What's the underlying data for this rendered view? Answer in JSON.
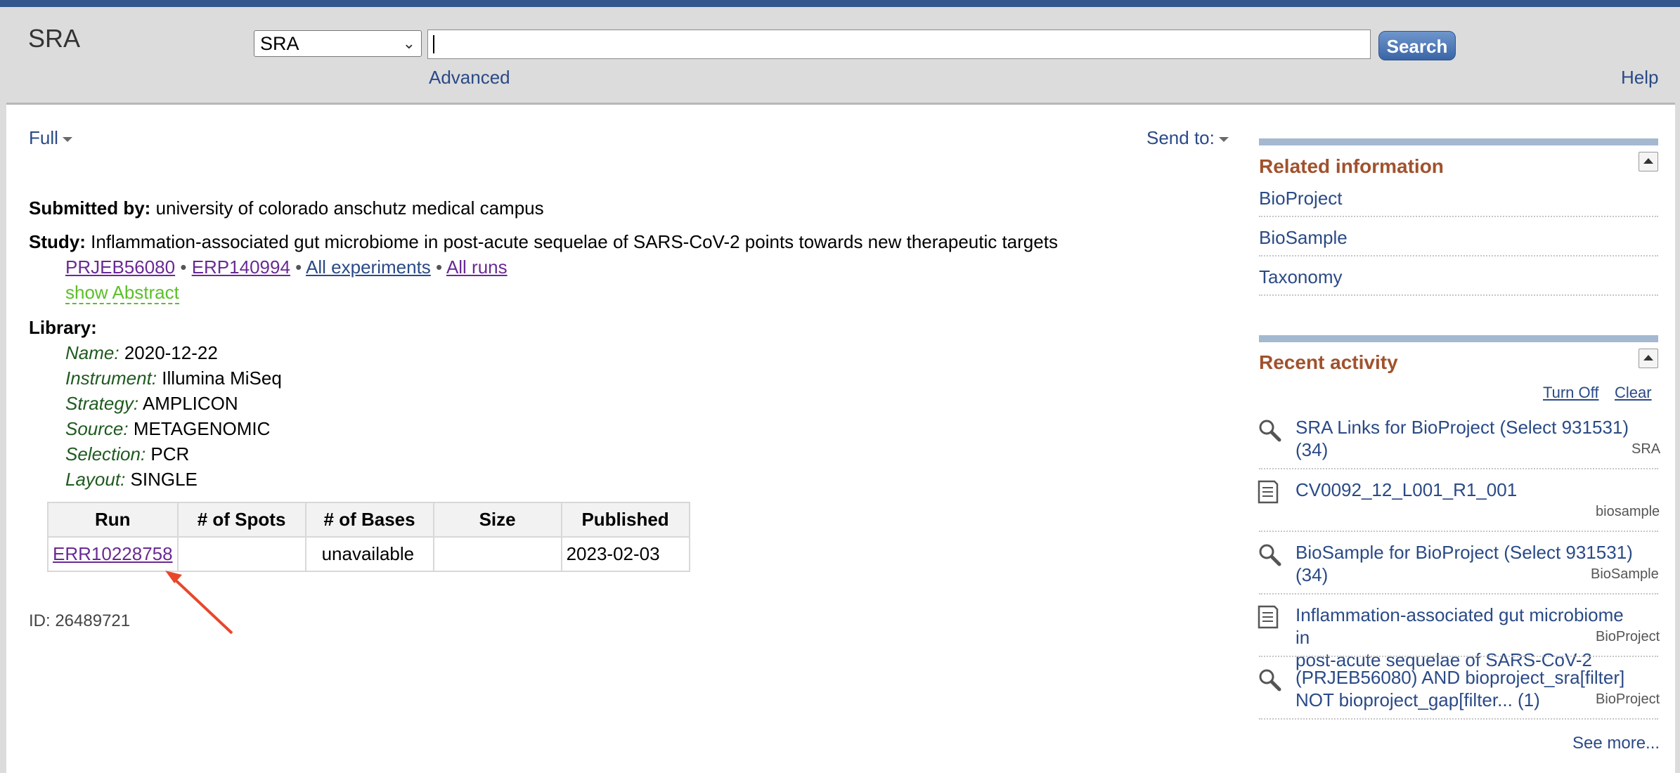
{
  "header": {
    "logo": "SRA",
    "db_selected": "SRA",
    "search_value": "",
    "search_button": "Search",
    "advanced_link": "Advanced",
    "help_link": "Help"
  },
  "toolbar": {
    "format_label": "Full",
    "send_to_label": "Send to:"
  },
  "record": {
    "submitted_by_label": "Submitted by:",
    "submitted_by_value": "university of colorado anschutz medical campus",
    "study_label": "Study:",
    "study_title": "Inflammation-associated gut microbiome in post-acute sequelae of SARS-CoV-2 points towards new therapeutic targets",
    "study_links": [
      "PRJEB56080",
      "ERP140994",
      "All experiments",
      "All runs"
    ],
    "separator": "•",
    "show_abstract": "show Abstract",
    "library_label": "Library:",
    "library_fields": [
      {
        "label": "Name:",
        "value": "2020-12-22"
      },
      {
        "label": "Instrument:",
        "value": "Illumina MiSeq"
      },
      {
        "label": "Strategy:",
        "value": "AMPLICON"
      },
      {
        "label": "Source:",
        "value": "METAGENOMIC"
      },
      {
        "label": "Selection:",
        "value": "PCR"
      },
      {
        "label": "Layout:",
        "value": "SINGLE"
      }
    ],
    "runs_table": {
      "headers": [
        "Run",
        "# of Spots",
        "# of Bases",
        "Size",
        "Published"
      ],
      "rows": [
        [
          "ERR10228758",
          "",
          "unavailable",
          "",
          "2023-02-03"
        ]
      ]
    },
    "id_text": "ID: 26489721"
  },
  "sidebar": {
    "related_title": "Related information",
    "related_links": [
      "BioProject",
      "BioSample",
      "Taxonomy"
    ],
    "recent_title": "Recent activity",
    "turn_off": "Turn Off",
    "clear": "Clear",
    "recent_items": [
      {
        "icon": "magnifier-icon",
        "line1": "SRA Links for BioProject (Select 931531)",
        "line2": "(34)",
        "tag": "SRA"
      },
      {
        "icon": "document-icon",
        "line1": "CV0092_12_L001_R1_001",
        "line2": "",
        "tag": "biosample"
      },
      {
        "icon": "magnifier-icon",
        "line1": "BioSample for BioProject (Select 931531)",
        "line2": "(34)",
        "tag": "BioSample"
      },
      {
        "icon": "document-icon",
        "line1": "Inflammation-associated gut microbiome in",
        "line2": "post-acute sequelae of SARS-CoV-2",
        "tag": "BioProject"
      },
      {
        "icon": "magnifier-icon",
        "line1": "(PRJEB56080) AND bioproject_sra[filter]",
        "line2": "NOT bioproject_gap[filter... (1)",
        "tag": "BioProject"
      }
    ],
    "see_more": "See more..."
  },
  "colors": {
    "top_bar": "#36578d",
    "header_bg": "#dcdcdc",
    "link": "#2a4a86",
    "visited_link": "#6a2a94",
    "sidebar_title": "#a0522d",
    "field_label": "#1f5a1f",
    "abstract_link": "#5cbf2a",
    "annotation_arrow": "#e8472a"
  }
}
